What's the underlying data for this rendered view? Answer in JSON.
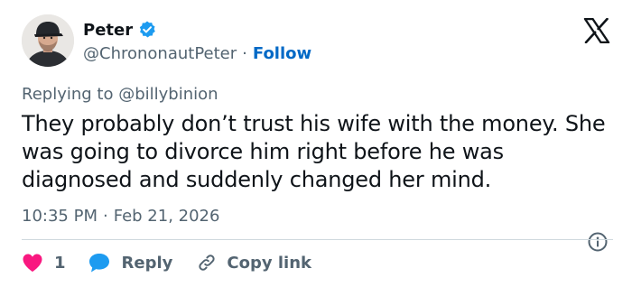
{
  "author": {
    "display_name": "Peter",
    "handle": "@ChrononautPeter",
    "follow_label": "Follow",
    "verified": true
  },
  "reply": {
    "prefix": "Replying to ",
    "mention": "@billybinion"
  },
  "tweet": {
    "text": "They probably don’t trust his wife with the money. She was going to divorce him right before he was diagnosed and suddenly changed her mind.",
    "time": "10:35 PM",
    "date": "Feb 21, 2026"
  },
  "actions": {
    "like_count": "1",
    "reply_label": "Reply",
    "copy_link_label": "Copy link"
  },
  "colors": {
    "like": "#f91880",
    "reply": "#1d9bf0",
    "verified": "#1d9bf0",
    "follow": "#0069c6",
    "secondary_text": "#536471"
  },
  "icons": [
    "x-logo-icon",
    "verified-badge-icon",
    "heart-icon",
    "reply-bubble-icon",
    "link-icon",
    "info-icon"
  ]
}
